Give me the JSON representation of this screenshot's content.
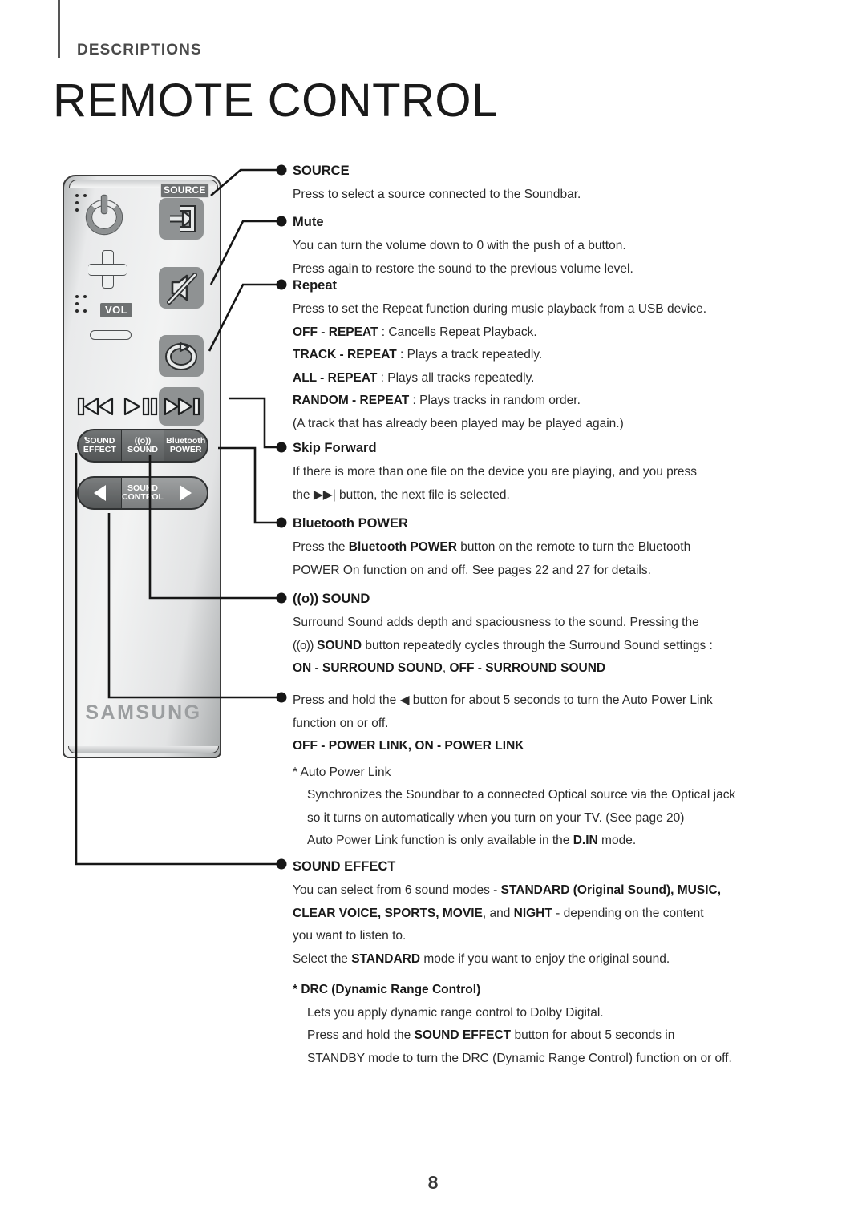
{
  "header": {
    "eyebrow": "DESCRIPTIONS",
    "title": "REMOTE CONTROL"
  },
  "remote": {
    "source_badge": "SOURCE",
    "vol_label": "VOL",
    "brand": "SAMSUNG",
    "buttons_row1": [
      {
        "line1": "SOUND",
        "line2": "EFFECT"
      },
      {
        "line1": "((o))",
        "line2": "SOUND"
      },
      {
        "line1": "Bluetooth",
        "line2": "POWER"
      }
    ],
    "buttons_row2": [
      {
        "line1": "SOUND",
        "line2": "CONTROL"
      }
    ]
  },
  "sections": [
    {
      "id": "source",
      "heading": "SOURCE",
      "lines": [
        "Press to select a source connected to the Soundbar."
      ]
    },
    {
      "id": "mute",
      "heading": "Mute",
      "lines": [
        "You can turn the volume down to 0 with the push of a button.",
        "Press again to restore the sound to the previous volume level."
      ]
    },
    {
      "id": "repeat",
      "heading": "Repeat",
      "lines": [
        "Press to set the Repeat function during music playback from a USB device.",
        "OFF - REPEAT : Cancells Repeat Playback.",
        "TRACK - REPEAT : Plays a track repeatedly.",
        "ALL - REPEAT : Plays all tracks repeatedly.",
        "RANDOM - REPEAT : Plays tracks in random order.",
        "(A track that has already been played may be played again.)"
      ]
    },
    {
      "id": "skip-forward",
      "heading": "Skip Forward",
      "lines": [
        "If there is more than one file on the device you are playing, and you press",
        "the ▶▶| button, the next file is selected."
      ]
    },
    {
      "id": "bluetooth-power",
      "heading": "Bluetooth POWER",
      "lines": [
        "Press the Bluetooth POWER button on the remote to turn the Bluetooth",
        "POWER On function on and off. See pages 22 and 27 for details."
      ]
    },
    {
      "id": "surround-sound",
      "heading": "((o)) SOUND",
      "lines": [
        "Surround Sound adds depth and spaciousness to the sound. Pressing the",
        "((o)) SOUND button repeatedly cycles through the Surround Sound settings :",
        "ON - SURROUND SOUND, OFF - SURROUND SOUND"
      ]
    },
    {
      "id": "auto-power-link",
      "heading": "",
      "lines": [
        "Press and hold the ◀ button for about 5 seconds to turn the Auto Power Link",
        "function on or off.",
        "OFF - POWER LINK, ON - POWER LINK",
        "* Auto Power Link",
        "Synchronizes the Soundbar to a connected Optical source via the Optical jack",
        "so it turns on automatically when you turn on your TV. (See page 20)",
        "Auto Power Link function is only available in the D.IN mode."
      ]
    },
    {
      "id": "sound-effect",
      "heading": "SOUND EFFECT",
      "lines": [
        "You can select from 6 sound modes - STANDARD (Original Sound), MUSIC,",
        "CLEAR VOICE, SPORTS, MOVIE, and NIGHT - depending on the content",
        "you want to listen to.",
        "Select the STANDARD mode if you want to enjoy the original sound.",
        "* DRC (Dynamic Range Control)",
        "Lets you apply dynamic range control to Dolby Digital.",
        "Press and hold the SOUND EFFECT button for about 5 seconds in",
        "STANDBY mode to turn the DRC (Dynamic Range Control) function on or off."
      ]
    }
  ],
  "footer": {
    "page_number": "8"
  },
  "colors": {
    "text": "#231f20",
    "rule": "#555555",
    "key_fill": "#8f9293",
    "badge_fill": "#6e7172",
    "logo": "#9b9ea0"
  }
}
